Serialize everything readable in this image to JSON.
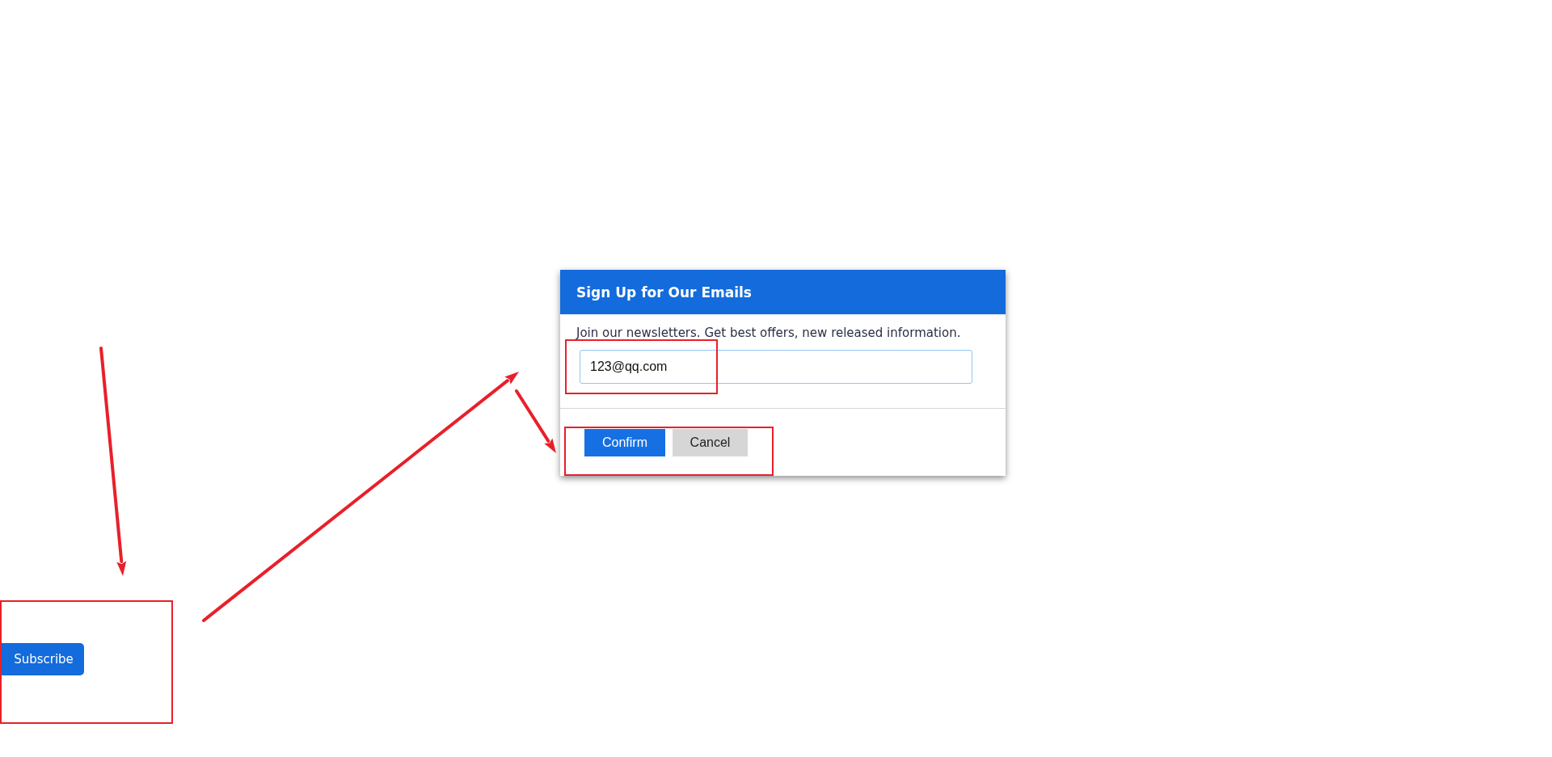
{
  "subscribe_button": {
    "label": "Subscribe"
  },
  "dialog": {
    "title": "Sign Up for Our Emails",
    "description": "Join our newsletters. Get best offers, new released information.",
    "email_field": {
      "value": "123@qq.com"
    },
    "buttons": [
      {
        "label": "Confirm",
        "kind": "primary"
      },
      {
        "label": "Cancel",
        "kind": "secondary"
      }
    ]
  }
}
